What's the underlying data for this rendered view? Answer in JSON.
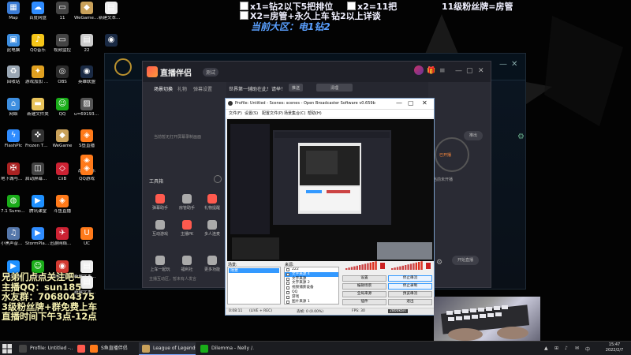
{
  "desktop": {
    "icons": [
      {
        "label": "Map",
        "color": "#3a7bd5",
        "glyph": "▦"
      },
      {
        "label": "百度网盘",
        "color": "#2f8cff",
        "glyph": "☁"
      },
      {
        "label": "11",
        "color": "#444444",
        "glyph": "▭"
      },
      {
        "label": "WeGame新版",
        "color": "#c9a15a",
        "glyph": "◆"
      },
      {
        "label": "新建文本文档",
        "color": "#eeeeee",
        "glyph": "▤"
      },
      {
        "label": "此电脑",
        "color": "#3d8ee0",
        "glyph": "▣"
      },
      {
        "label": "QQ音乐",
        "color": "#f5c518",
        "glyph": "♪"
      },
      {
        "label": "视频监控",
        "color": "#444444",
        "glyph": "▭"
      },
      {
        "label": "22",
        "color": "#cccccc",
        "glyph": "▤"
      },
      {
        "label": "",
        "color": "#1a2a44",
        "glyph": "◉"
      },
      {
        "label": "回收站",
        "color": "#9aa7b4",
        "glyph": "♻"
      },
      {
        "label": "游戏加加 0.6.24",
        "color": "#e0a020",
        "glyph": "✦"
      },
      {
        "label": "OBS",
        "color": "#2b2b2b",
        "glyph": "◎"
      },
      {
        "label": "英雄联盟",
        "color": "#1a2a44",
        "glyph": "◉"
      },
      {
        "label": "网络",
        "color": "#3d8ee0",
        "glyph": "⌂"
      },
      {
        "label": "新建文件夹",
        "color": "#e8c35a",
        "glyph": "▬"
      },
      {
        "label": "QQ",
        "color": "#1aad19",
        "glyph": "☺"
      },
      {
        "label": "u=691933…",
        "color": "#555555",
        "glyph": "▨"
      },
      {
        "label": "FlashPlc",
        "color": "#2f8cff",
        "glyph": "ϟ"
      },
      {
        "label": "Frozen Throne",
        "color": "#333333",
        "glyph": "✜"
      },
      {
        "label": "WeGame",
        "color": "#c9a15a",
        "glyph": "◆"
      },
      {
        "label": "S鱼直播",
        "color": "#ff7a1a",
        "glyph": "◈"
      },
      {
        "label": "战士鱼乐",
        "color": "#ff7a1a",
        "glyph": "◈"
      },
      {
        "label": "地下城与勇士",
        "color": "#aa2222",
        "glyph": "✠"
      },
      {
        "label": "启动屏幕捕获",
        "color": "#444444",
        "glyph": "◫"
      },
      {
        "label": "CiiB",
        "color": "#cc2233",
        "glyph": "◇"
      },
      {
        "label": "QQ游戏",
        "color": "#ff7a1a",
        "glyph": "◈"
      },
      {
        "label": "7.1 Surrou…",
        "color": "#1aad19",
        "glyph": "◍"
      },
      {
        "label": "腾讯课堂",
        "color": "#1e90ff",
        "glyph": "▶"
      },
      {
        "label": "斗鱼直播",
        "color": "#ff7a1a",
        "glyph": "◈"
      },
      {
        "label": "小黑声音管理",
        "color": "#5577aa",
        "glyph": "♫"
      },
      {
        "label": "StormPlayer",
        "color": "#2f8cff",
        "glyph": "▶"
      },
      {
        "label": "迅游网络加速",
        "color": "#cc2233",
        "glyph": "✈"
      },
      {
        "label": "UC",
        "color": "#ff7a1a",
        "glyph": "U"
      },
      {
        "label": "腾讯视频",
        "color": "#1e90ff",
        "glyph": "▶"
      },
      {
        "label": "腾讯QQ",
        "color": "#1aad19",
        "glyph": "☺"
      },
      {
        "label": "网易云音乐",
        "color": "#d33a31",
        "glyph": "◉"
      },
      {
        "label": "新建文本文档",
        "color": "#eeeeee",
        "glyph": "▤"
      },
      {
        "label": "新建文本文档",
        "color": "#eeeeee",
        "glyph": "▤"
      },
      {
        "label": "新建文本文档",
        "color": "#eeeeee",
        "glyph": "▤"
      }
    ]
  },
  "overlays": {
    "top_left_line1": "x1=钻2以下5把排位",
    "top_left_line2": "X2=房管+永久上车",
    "top_mid_line1": "x2=11把",
    "top_mid_line2": "钻2以上详谈",
    "top_right": "11级粉丝牌=房管",
    "region": "当前大区：电1钻2",
    "bottom_lines": [
      "兄弟们点点关注吧~",
      "主播QQ：sun185",
      "水友群：706804375",
      "3级粉丝牌+群免费上车",
      "直播时间下午3点-12点"
    ]
  },
  "live_app": {
    "name": "直播伴侣",
    "version": "测试",
    "tabs": [
      "场景切换",
      "礼物",
      "弹幕设置"
    ],
    "empty_tip": "当前暂无打开屏幕录制画面",
    "tools_title": "工具箱",
    "tools": [
      {
        "label": "弹幕助手",
        "color": "#ff5a4e"
      },
      {
        "label": "房管助手",
        "color": "#aaaaaa"
      },
      {
        "label": "礼物提醒",
        "color": "#ff5a4e"
      },
      {
        "label": "互动游戏",
        "color": "#aaaaaa"
      },
      {
        "label": "主播PK",
        "color": "#ff5a4e"
      },
      {
        "label": "多人连麦",
        "color": "#aaaaaa"
      },
      {
        "label": "上车一起玩",
        "color": "#aaaaaa"
      },
      {
        "label": "福利社",
        "color": "#aaaaaa"
      },
      {
        "label": "更多功能",
        "color": "#aaaaaa"
      }
    ],
    "top_message": "世界第一辅助在此！请举！",
    "msg_btn1": "推送",
    "msg_btn2": "清理",
    "right_status": "已开播",
    "right_sub": "当前未开播",
    "right_top_btn": "推出",
    "right_bottom_btn": "开始直播",
    "bottom_hint": "主播互动区，暂未有人发言"
  },
  "obs": {
    "title": "Profile: Untitled - Scenes: scenes - Open Broadcaster Software v0.659b",
    "menu": [
      "文件(F)",
      "设置(S)",
      "配置文件(P)",
      "场景集合(C)",
      "帮助(H)"
    ],
    "scenes_label": "场景:",
    "sources_label": "来源:",
    "scenes": [
      "场景"
    ],
    "sources": [
      {
        "label": "222",
        "selected": false
      },
      {
        "label": "文字来源 4",
        "selected": true
      },
      {
        "label": "文字来源",
        "selected": false
      },
      {
        "label": "文字来源 2",
        "selected": false
      },
      {
        "label": "视频捕获设备",
        "selected": false
      },
      {
        "label": "QQ",
        "selected": false
      },
      {
        "label": "游戏",
        "selected": false
      },
      {
        "label": "图片来源 1",
        "selected": false
      }
    ],
    "buttons": [
      {
        "label": "设置",
        "primary": false
      },
      {
        "label": "停止串流",
        "primary": true
      },
      {
        "label": "编辑场景",
        "primary": false
      },
      {
        "label": "停止录制",
        "primary": true
      },
      {
        "label": "全局来源",
        "primary": false
      },
      {
        "label": "预览串流",
        "primary": false
      },
      {
        "label": "插件",
        "primary": false
      },
      {
        "label": "退出",
        "primary": false
      }
    ],
    "status": {
      "time": "0:08:11",
      "mode": "(LIVE + REC)",
      "dropped": "丢帧: 0 (0.00%)",
      "fps": "FPS: 30",
      "bitrate": "2800kb/s"
    }
  },
  "taskbar": {
    "items": [
      {
        "label": "Profile: Untitled -…",
        "color": "#444444",
        "active": false
      },
      {
        "label": "",
        "color": "#ff5a4e",
        "active": false
      },
      {
        "label": "S鱼直播伴侣",
        "color": "#ff7a1a",
        "active": false
      },
      {
        "label": "League of Legends",
        "color": "#c9a15a",
        "active": true
      },
      {
        "label": "Dilemma - Nelly /…",
        "color": "#1aad19",
        "active": false
      }
    ],
    "tray_icons": [
      "▲",
      "⊞",
      "♪",
      "✉",
      "中"
    ],
    "time": "15:47",
    "date": "2022/2/7"
  }
}
